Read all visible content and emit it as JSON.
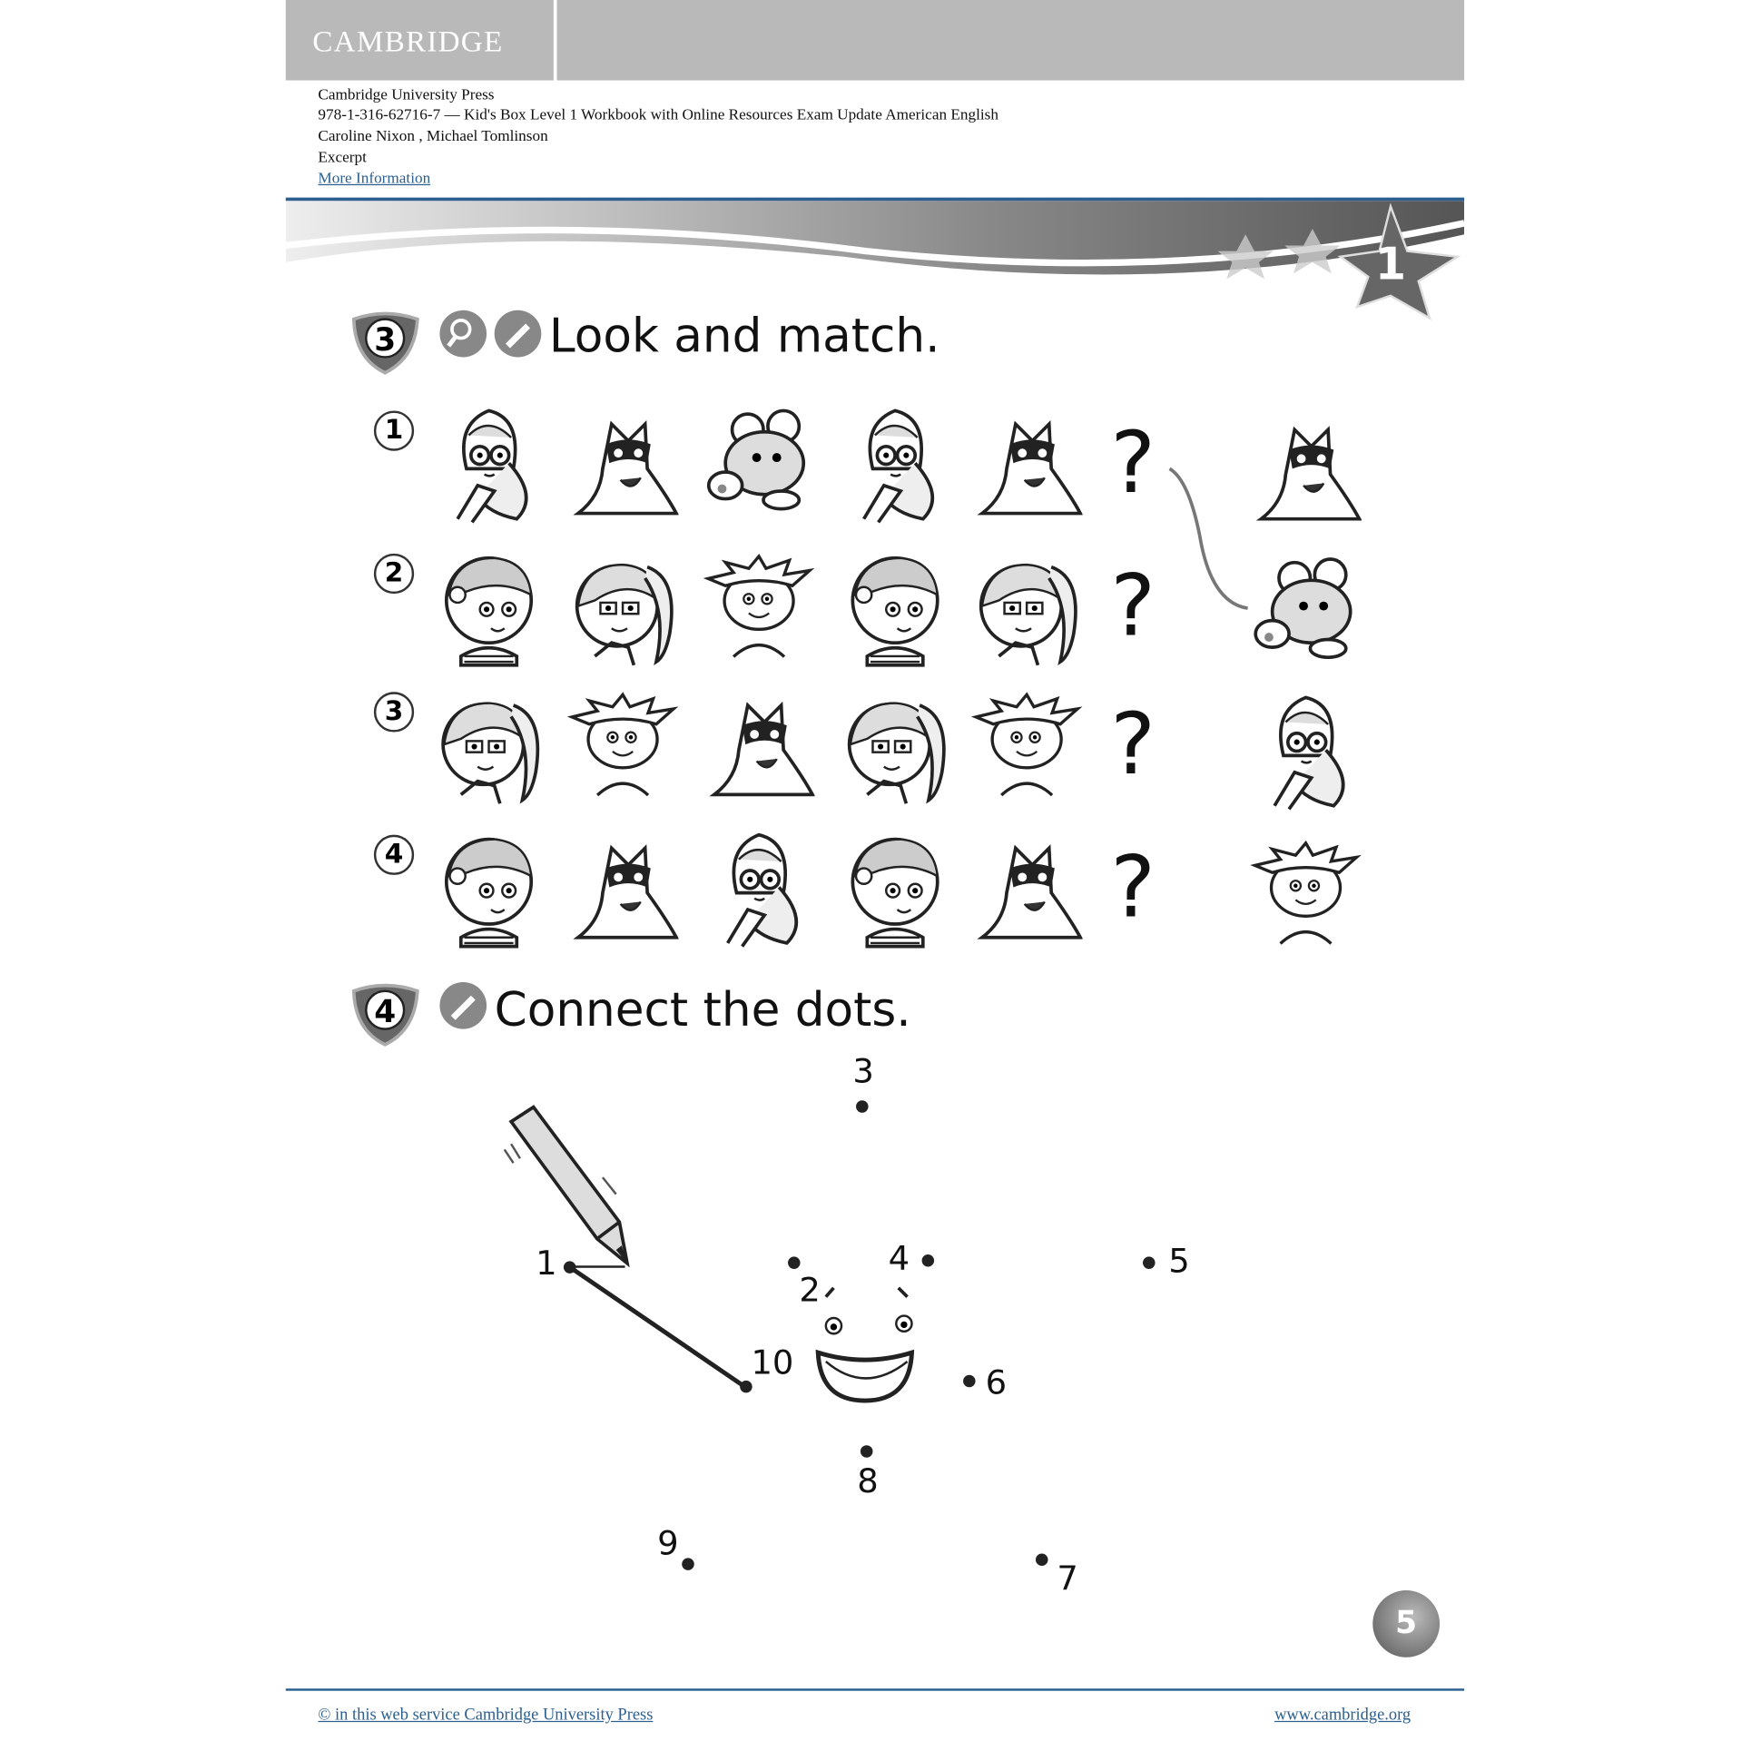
{
  "header": {
    "logo": "CAMBRIDGE",
    "publisher": "Cambridge University Press",
    "book": "978-1-316-62716-7 — Kid's Box Level 1 Workbook with Online Resources Exam Update American English",
    "authors": "Caroline Nixon , Michael Tomlinson",
    "type": "Excerpt",
    "more_info": "More Information"
  },
  "unit_number": "1",
  "exercise3": {
    "number": "3",
    "title": "Look and match.",
    "icons": [
      "magnifier-icon",
      "pencil-icon"
    ],
    "rows": [
      {
        "label": "1",
        "sequence": [
          "girl-glasses",
          "cat-mask",
          "mouse",
          "girl-glasses",
          "cat-mask"
        ],
        "missing": "?"
      },
      {
        "label": "2",
        "sequence": [
          "girl-flower",
          "girl-ponytail",
          "boy-spiky",
          "girl-flower",
          "girl-ponytail"
        ],
        "missing": "?"
      },
      {
        "label": "3",
        "sequence": [
          "girl-ponytail",
          "boy-spiky",
          "cat-mask",
          "girl-ponytail",
          "boy-spiky"
        ],
        "missing": "?"
      },
      {
        "label": "4",
        "sequence": [
          "girl-flower",
          "cat-mask",
          "girl-glasses",
          "girl-flower",
          "cat-mask"
        ],
        "missing": "?"
      }
    ],
    "answers": [
      "cat-mask",
      "mouse",
      "girl-glasses",
      "boy-spiky"
    ],
    "example_match": {
      "row": "1",
      "answer": "mouse"
    }
  },
  "exercise4": {
    "number": "4",
    "title": "Connect the dots.",
    "icons": [
      "pencil-icon"
    ],
    "dots": [
      {
        "label": "1"
      },
      {
        "label": "2"
      },
      {
        "label": "3"
      },
      {
        "label": "4"
      },
      {
        "label": "5"
      },
      {
        "label": "6"
      },
      {
        "label": "7"
      },
      {
        "label": "8"
      },
      {
        "label": "9"
      },
      {
        "label": "10"
      }
    ],
    "connected": [
      [
        "1",
        "10"
      ]
    ]
  },
  "page_number": "5",
  "footer": {
    "copyright": "© in this web service Cambridge University Press",
    "site": "www.cambridge.org"
  },
  "colors": {
    "link": "#2a5f8f",
    "header_bar": "#b9b9b9"
  }
}
